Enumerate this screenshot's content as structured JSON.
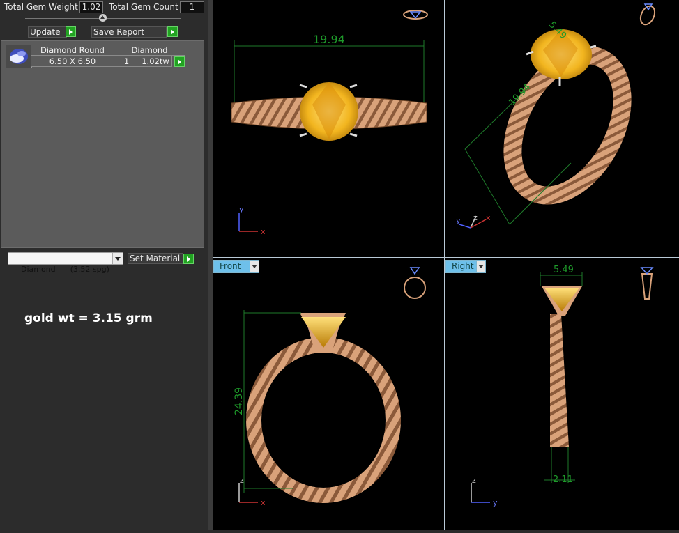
{
  "summary": {
    "total_gem_weight_label": "Total Gem Weight",
    "total_gem_weight_value": "1.02",
    "total_gem_count_label": "Total Gem Count",
    "total_gem_count_value": "1"
  },
  "actions": {
    "update_label": "Update",
    "save_report_label": "Save Report"
  },
  "gem_table": {
    "row": {
      "shape": "Diamond Round",
      "material": "Diamond",
      "size": "6.50 X 6.50",
      "count": "1",
      "weight": "1.02tw"
    },
    "thumbnail_icon": "gem-round-icon"
  },
  "material_select": {
    "selected": "Diamond      (3.52 spg)",
    "set_material_label": "Set Material"
  },
  "note": "gold wt = 3.15 grm",
  "viewports": {
    "top_left": {
      "width_dim": "19.94",
      "axis_x": "x",
      "axis_y": "y"
    },
    "top_right": {
      "dim_top": "5.49",
      "dim_diag": "19.94",
      "axis_x": "x",
      "axis_y": "y",
      "axis_z": "z"
    },
    "bottom_left": {
      "tab": "Front",
      "height_dim": "24.39",
      "axis_x": "x",
      "axis_z": "z"
    },
    "bottom_right": {
      "tab": "Right",
      "dim_top": "5.49",
      "dim_bottom": "2.11",
      "axis_y": "y",
      "axis_z": "z"
    }
  },
  "colors": {
    "gold": "#d9a27a",
    "gem": "#f2b51f",
    "dimension": "#1e7a2a",
    "tab_active": "#6ec0ea",
    "go_button": "#22a322"
  }
}
